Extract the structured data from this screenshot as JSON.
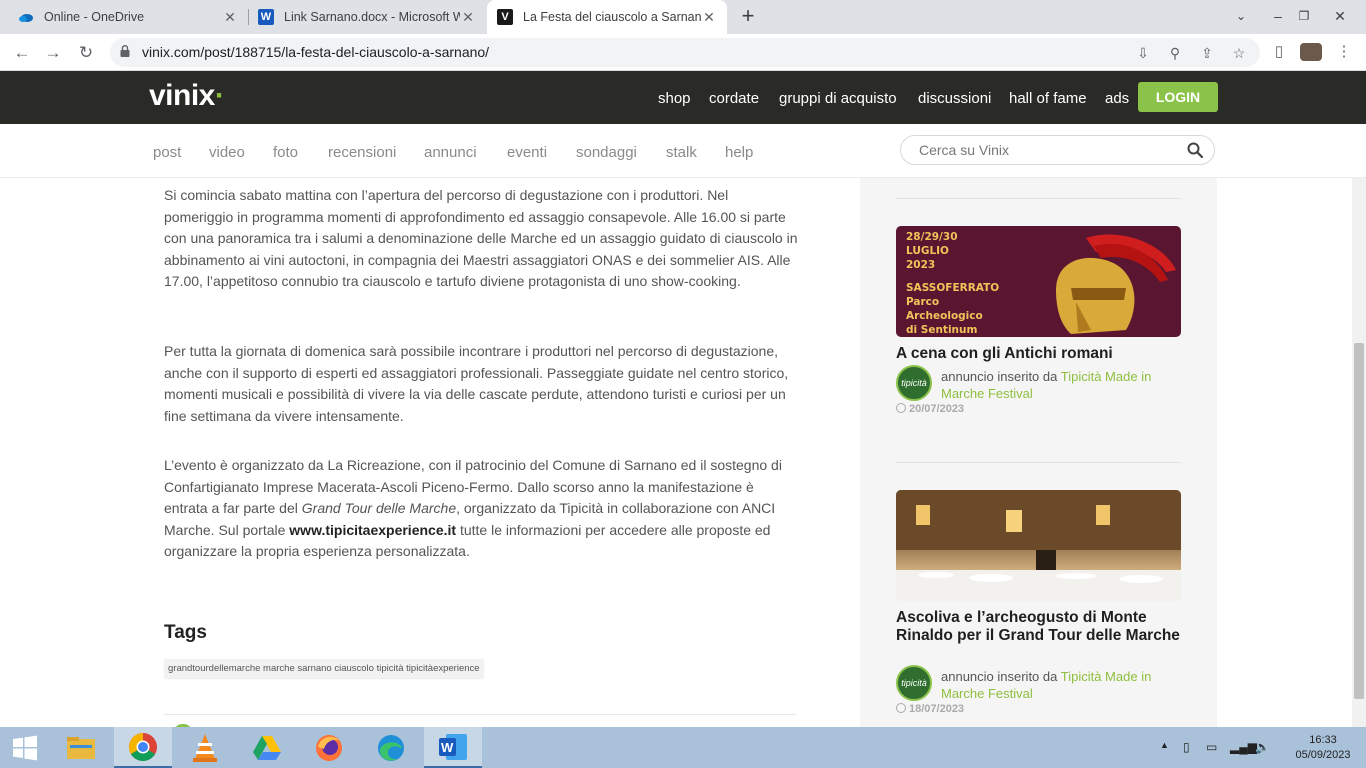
{
  "browser": {
    "tabs": [
      {
        "title": "Online - OneDrive",
        "active": false
      },
      {
        "title": "Link Sarnano.docx - Microsoft Word",
        "active": false
      },
      {
        "title": "La Festa del ciauscolo a Sarnano",
        "active": true
      }
    ],
    "url": "vinix.com/post/188715/la-festa-del-ciauscolo-a-sarnano/"
  },
  "site": {
    "logo": "vinix",
    "top_nav": [
      "shop",
      "cordate",
      "gruppi di acquisto",
      "discussioni",
      "hall of fame",
      "ads"
    ],
    "login_label": "LOGIN",
    "sub_nav": [
      "post",
      "video",
      "foto",
      "recensioni",
      "annunci",
      "eventi",
      "sondaggi",
      "stalk",
      "help"
    ],
    "search_placeholder": "Cerca su Vinix"
  },
  "article": {
    "paragraphs": [
      "Si comincia sabato mattina con l’apertura del percorso di degustazione con i produttori. Nel pomeriggio in programma momenti di approfondimento ed assaggio consapevole. Alle 16.00 si parte con una panoramica tra i salumi a denominazione delle Marche ed un assaggio guidato di ciauscolo in abbinamento ai vini autoctoni, in compagnia dei Maestri assaggiatori ONAS e dei sommelier AIS. Alle 17.00, l’appetitoso connubio tra ciauscolo e tartufo diviene protagonista di uno show-cooking.",
      "Per tutta la giornata di domenica sarà possibile incontrare i produttori nel percorso di degustazione, anche con il supporto di esperti ed assaggiatori professionali. Passeggiate guidate nel centro storico, momenti musicali e possibilità di vivere la via delle cascate perdute, attendono turisti e curiosi per un fine settimana da vivere intensamente."
    ],
    "para3": {
      "a": "L’evento è organizzato da La Ricreazione, con il patrocinio del Comune di Sarnano ed il sostegno di Confartigianato Imprese Macerata-Ascoli Piceno-Fermo. Dallo scorso anno la manifestazione è entrata a far parte del ",
      "italic": "Grand Tour delle Marche",
      "b": ", organizzato da Tipicità in collaborazione con ANCI Marche. Sul portale ",
      "link": "www.tipicitaexperience.it",
      "c": " tutte le informazioni per accedere alle proposte ed organizzare la propria esperienza personalizzata."
    },
    "tags_title": "Tags",
    "tags": "grandtourdellemarche marche sarnano ciauscolo tipicità tipicitàexperience"
  },
  "sidebar": {
    "cards": [
      {
        "poster_lines": [
          "28/29/30",
          "LUGLIO",
          "2023",
          "SASSOFERRATO",
          "Parco",
          "Archeologico",
          "di Sentinum"
        ],
        "title": "A cena con gli Antichi romani",
        "avatar": "tipicità",
        "by_prefix": "annuncio inserito da ",
        "author": "Tipicità Made in Marche Festival",
        "date": "20/07/2023"
      },
      {
        "title": "Ascoliva e l’archeogusto di Monte Rinaldo per il Grand Tour delle Marche",
        "avatar": "tipicità",
        "by_prefix": "annuncio inserito da ",
        "author": "Tipicità Made in Marche Festival",
        "date": "18/07/2023"
      }
    ]
  },
  "taskbar": {
    "time": "16:33",
    "date": "05/09/2023"
  },
  "colors": {
    "brand_green": "#8bc34a",
    "header_dark": "#2a2a27"
  }
}
